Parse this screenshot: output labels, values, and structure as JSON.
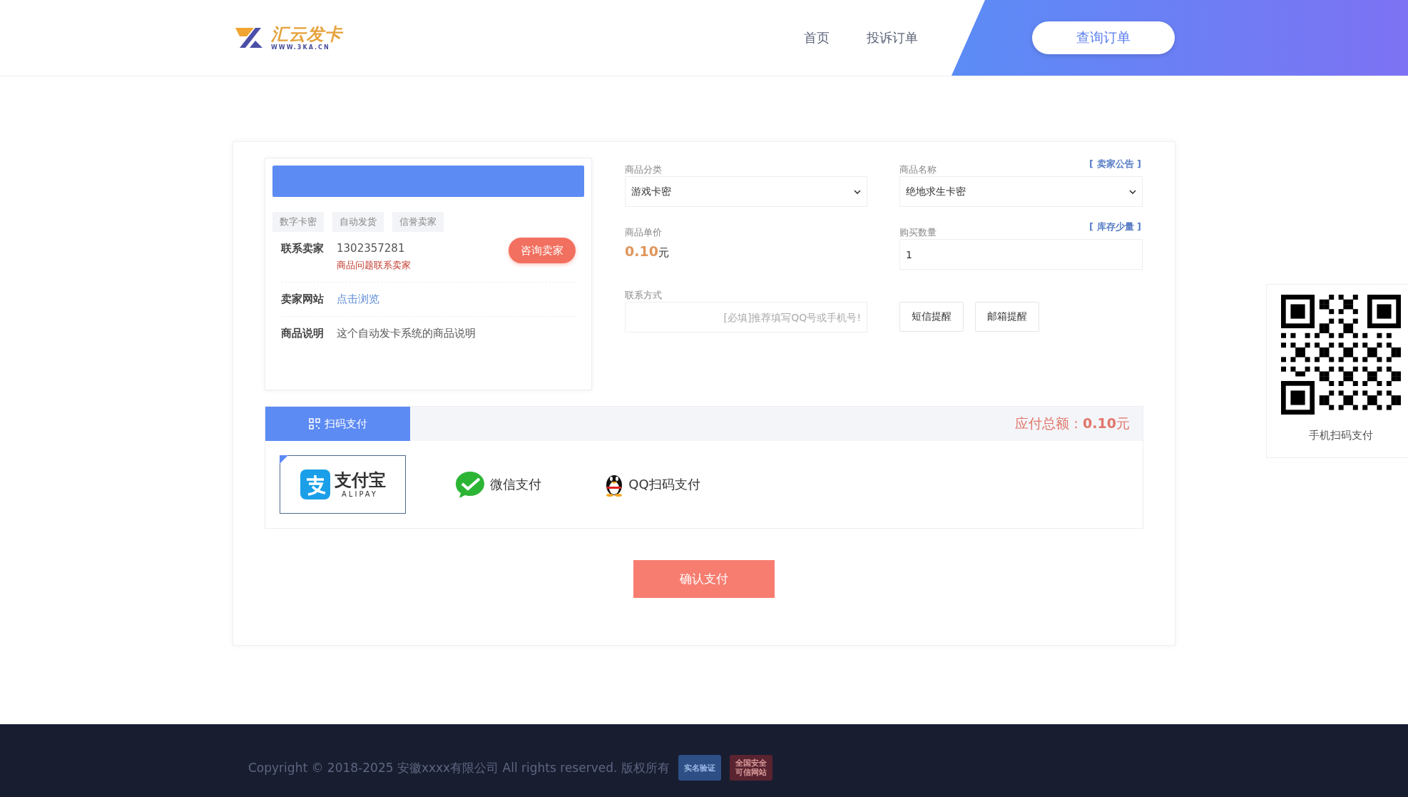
{
  "header": {
    "logo": {
      "name": "汇云发卡",
      "url": "WWW.3KA.CN"
    },
    "nav": [
      {
        "label": "首页"
      },
      {
        "label": "投诉订单"
      }
    ],
    "query_button": "查询订单"
  },
  "seller_card": {
    "tags": [
      "数字卡密",
      "自动发货",
      "信誉卖家"
    ],
    "rows": [
      {
        "kind": "contact",
        "label": "联系卖家",
        "value": "1302357281",
        "note": "商品问题联系卖家",
        "button": "咨询卖家"
      },
      {
        "kind": "link",
        "label": "卖家网站",
        "value": "点击浏览"
      },
      {
        "kind": "text",
        "label": "商品说明",
        "value": "这个自动发卡系统的商品说明"
      }
    ]
  },
  "form": {
    "category": {
      "label": "商品分类",
      "value": "游戏卡密"
    },
    "product": {
      "label": "商品名称",
      "value": "绝地求生卡密",
      "link": "[ 卖家公告 ]"
    },
    "price": {
      "label": "商品单价",
      "value": "0.10",
      "unit": "元"
    },
    "quantity": {
      "label": "购买数量",
      "value": "1",
      "link": "[ 库存少量 ]"
    },
    "contact": {
      "label": "联系方式",
      "placeholder": "[必填]推荐填写QQ号或手机号!"
    },
    "reminders": [
      {
        "label": "短信提醒"
      },
      {
        "label": "邮箱提醒"
      }
    ]
  },
  "payment": {
    "tabs": [
      {
        "label": "扫码支付",
        "selected": true
      }
    ],
    "total_label": "应付总额：",
    "total": "0.10",
    "unit": "元",
    "methods": [
      {
        "kind": "alipay",
        "name": "支付宝",
        "sub": "ALIPAY",
        "selected": true
      },
      {
        "kind": "wechat",
        "name": "微信支付",
        "selected": false
      },
      {
        "kind": "qq",
        "name": "QQ扫码支付",
        "selected": false
      }
    ]
  },
  "confirm_button": "确认支付",
  "qr_panel": {
    "caption": "手机扫码支付"
  },
  "footer": {
    "copyright": "Copyright © 2018-2025 安徽xxxx有限公司 All rights reserved. 版权所有",
    "badges": [
      {
        "lines": [
          "实名验证"
        ]
      },
      {
        "lines": [
          "全国安全",
          "可信网站"
        ]
      }
    ]
  }
}
